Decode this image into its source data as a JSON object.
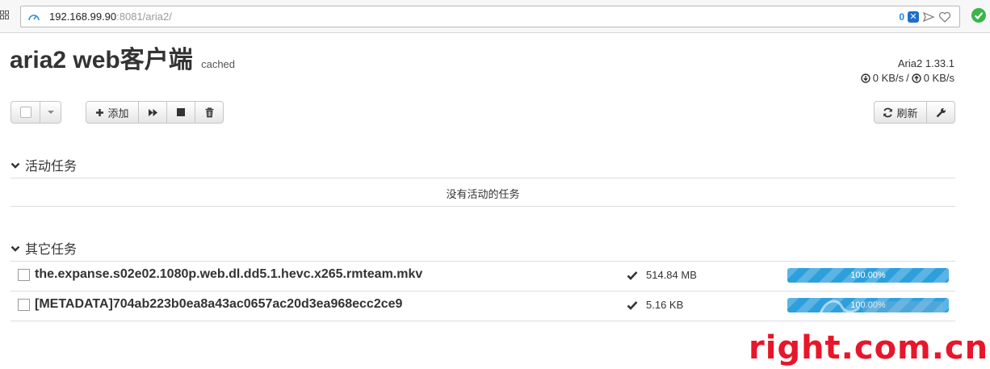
{
  "browser": {
    "url_host": "192.168.99.90",
    "url_rest": ":8081/aria2/",
    "badge_count": "0"
  },
  "header": {
    "title": "aria2 web客户端",
    "cached": "cached",
    "version": "Aria2 1.33.1",
    "download_speed": "0 KB/s",
    "separator": "/",
    "upload_speed": "0 KB/s"
  },
  "toolbar": {
    "add_label": "添加",
    "refresh_label": "刷新"
  },
  "active": {
    "title": "活动任务",
    "empty_text": "没有活动的任务"
  },
  "other": {
    "title": "其它任务",
    "tasks": [
      {
        "name": "the.expanse.s02e02.1080p.web.dl.dd5.1.hevc.x265.rmteam.mkv",
        "size": "514.84 MB",
        "progress": 100,
        "progress_label": "100.00%"
      },
      {
        "name": "[METADATA]704ab223b0ea8a43ac0657ac20d3ea968ecc2ce9",
        "size": "5.16 KB",
        "progress": 100,
        "progress_label": "100.00%"
      }
    ]
  },
  "watermark": {
    "text": "right.com.cn"
  },
  "colors": {
    "progress": "#2d9fdc",
    "watermark": "#e8162a",
    "ok": "#3bb54a"
  }
}
